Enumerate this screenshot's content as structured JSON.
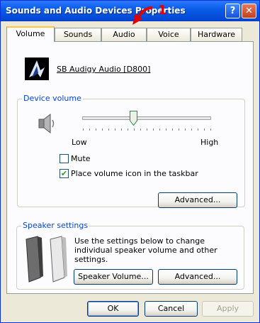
{
  "window": {
    "title": "Sounds and Audio Devices Properties",
    "help_label": "?",
    "close_label": "✕"
  },
  "annotation": {
    "label": "1"
  },
  "tabs": [
    {
      "label": "Volume",
      "active": true
    },
    {
      "label": "Sounds",
      "active": false
    },
    {
      "label": "Audio",
      "active": false
    },
    {
      "label": "Voice",
      "active": false
    },
    {
      "label": "Hardware",
      "active": false
    }
  ],
  "device": {
    "name": "SB Audigy Audio [D800]"
  },
  "device_volume": {
    "group_title": "Device volume",
    "low_label": "Low",
    "high_label": "High",
    "level_percent": 40,
    "mute_label": "Mute",
    "mute_checked": false,
    "taskbar_label": "Place volume icon in the taskbar",
    "taskbar_checked": true,
    "advanced_label": "Advanced..."
  },
  "speaker_settings": {
    "group_title": "Speaker settings",
    "description": "Use the settings below to change individual speaker volume and other settings.",
    "speaker_volume_label": "Speaker Volume...",
    "advanced_label": "Advanced..."
  },
  "footer": {
    "ok_label": "OK",
    "cancel_label": "Cancel",
    "apply_label": "Apply"
  }
}
